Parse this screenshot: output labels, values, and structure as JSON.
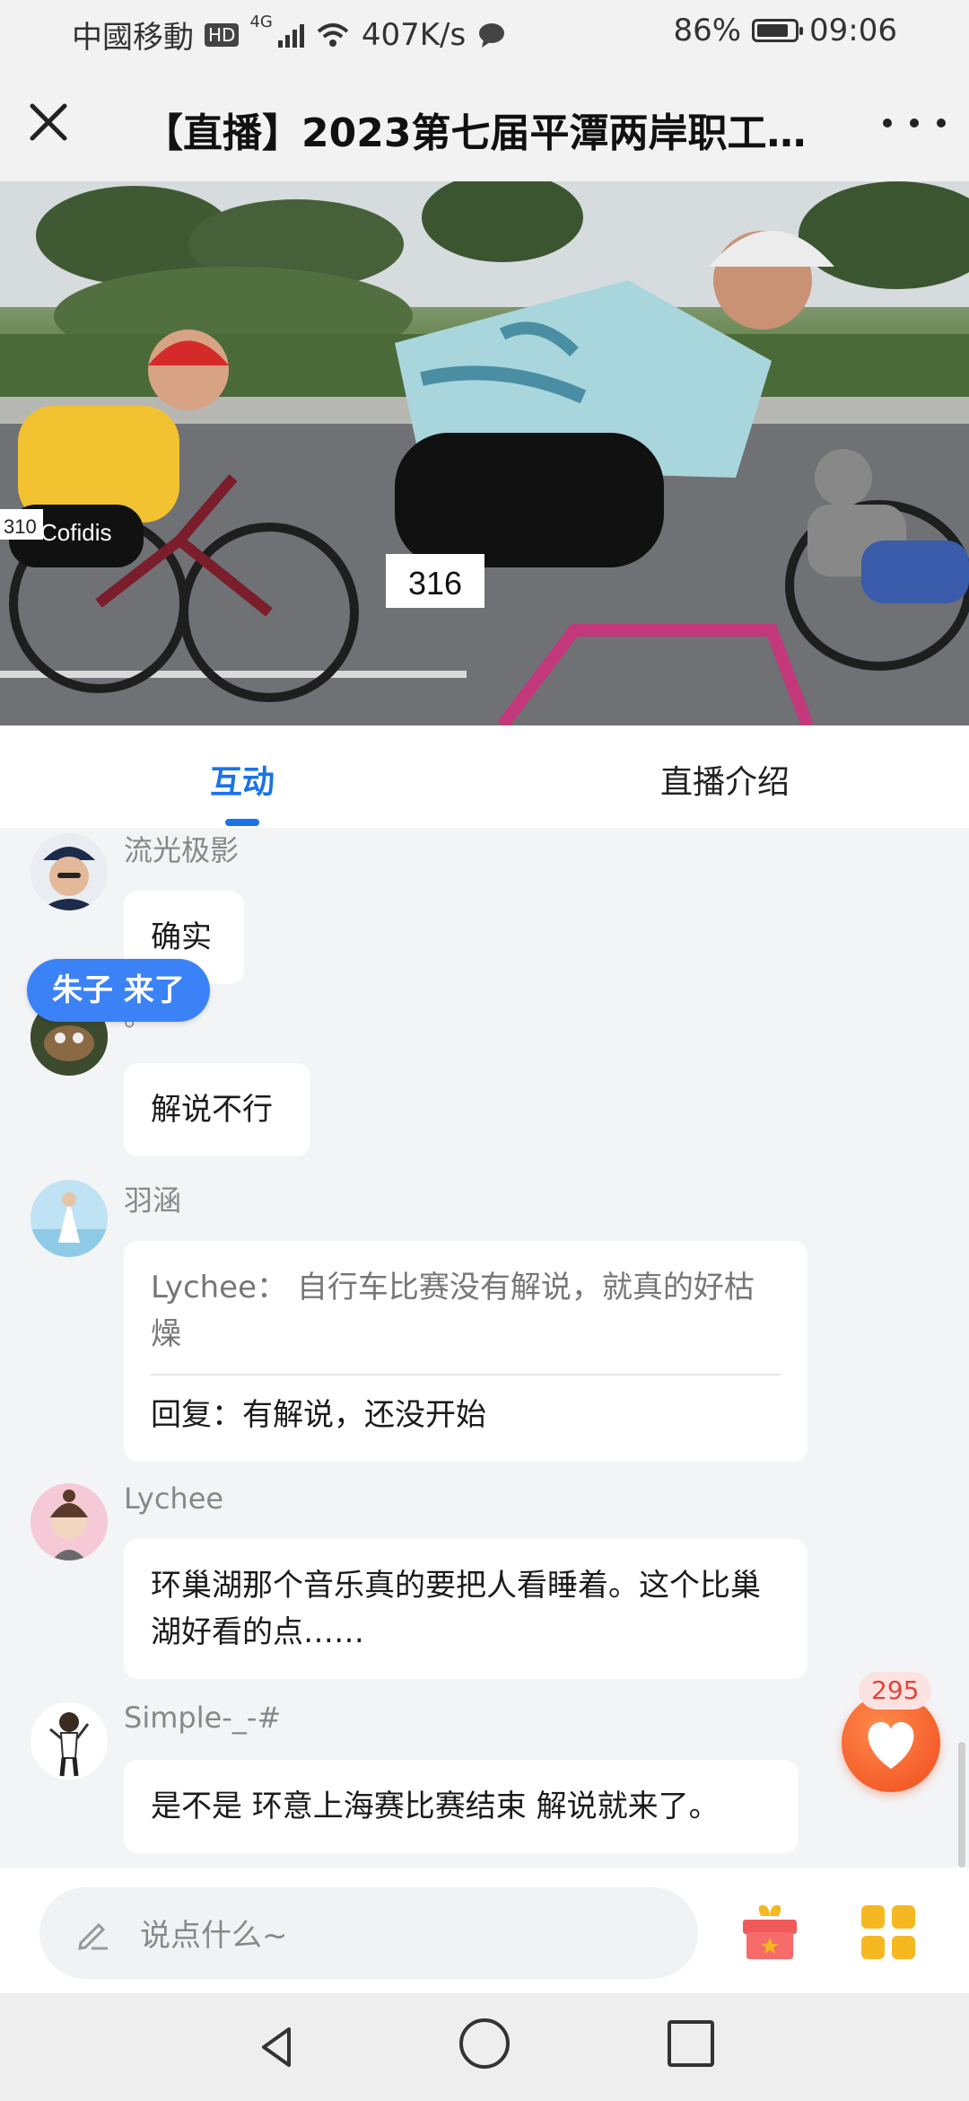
{
  "status_bar": {
    "carrier": "中國移動",
    "hd": "HD",
    "network": "4G",
    "speed": "407K/s",
    "battery": "86%",
    "battery_level": 0.86,
    "time": "09:06"
  },
  "header": {
    "title": "【直播】2023第七届平潭两岸职工…"
  },
  "video": {
    "bib_front": "316",
    "bib_left": "310",
    "jersey_text": "Cofidis",
    "accent": "#f2c230"
  },
  "tabs": [
    {
      "label": "互动",
      "active": true
    },
    {
      "label": "直播介绍",
      "active": false
    }
  ],
  "join_notice": "朱子 来了",
  "messages": [
    {
      "user": "流光极影",
      "text": "确实"
    },
    {
      "user": "。",
      "text": "解说不行"
    },
    {
      "user": "羽涵",
      "quote": "Lychee：  自行车比赛没有解说，就真的好枯燥",
      "text": "回复：有解说，还没开始"
    },
    {
      "user": "Lychee",
      "text": "环巢湖那个音乐真的要把人看睡着。这个比巢湖好看的点……"
    },
    {
      "user": "Simple-_-#",
      "text": "是不是 环意上海赛比赛结束 解说就来了。"
    }
  ],
  "like": {
    "count": "295",
    "color": "#f04b1c"
  },
  "input": {
    "placeholder": "说点什么~"
  },
  "colors": {
    "accent": "#1a73e8",
    "badge": "#3b82f6"
  }
}
